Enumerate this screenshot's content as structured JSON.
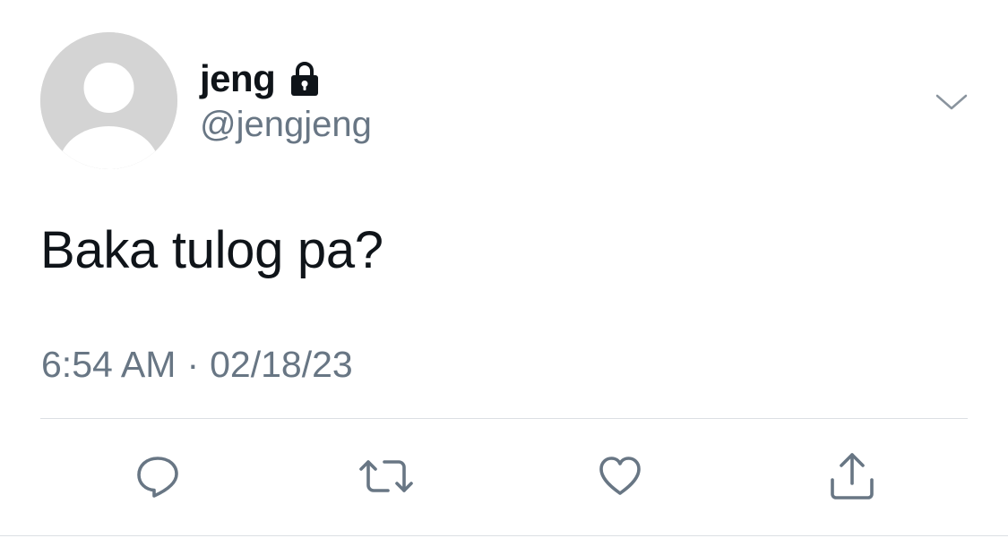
{
  "tweet": {
    "display_name": "jeng",
    "handle": "@jengjeng",
    "text": "Baka tulog pa?",
    "time": "6:54 AM",
    "separator": "·",
    "date": "02/18/23",
    "protected": true
  },
  "icons": {
    "avatar": "default-avatar-icon",
    "lock": "lock-icon",
    "more": "chevron-down-icon",
    "reply": "reply-icon",
    "retweet": "retweet-icon",
    "like": "heart-icon",
    "share": "share-icon"
  },
  "colors": {
    "text_primary": "#0f1419",
    "text_secondary": "#687684",
    "icon_gray": "#687684",
    "divider": "#dcdfe3",
    "avatar_bg": "#d4d4d4"
  }
}
